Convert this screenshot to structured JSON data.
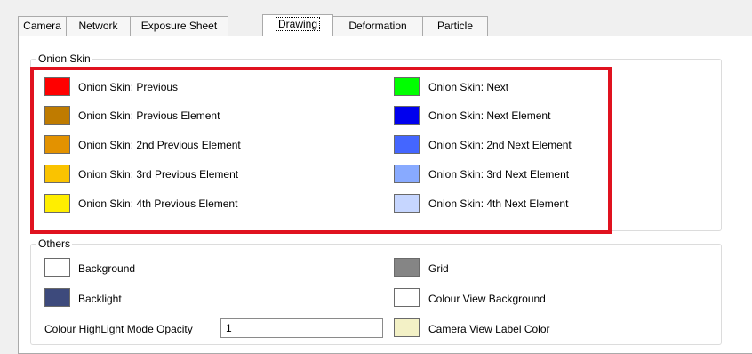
{
  "tabs": [
    {
      "label": "Camera"
    },
    {
      "label": "Network"
    },
    {
      "label": "Exposure Sheet"
    },
    {
      "label": "Drawing"
    },
    {
      "label": "Deformation"
    },
    {
      "label": "Particle"
    }
  ],
  "active_tab": "Drawing",
  "onion_skin": {
    "title": "Onion Skin",
    "left": [
      {
        "label": "Onion Skin: Previous",
        "color": "#ff0000"
      },
      {
        "label": "Onion Skin: Previous Element",
        "color": "#bf7b00"
      },
      {
        "label": "Onion Skin: 2nd Previous Element",
        "color": "#e39200"
      },
      {
        "label": "Onion Skin: 3rd Previous Element",
        "color": "#fac300"
      },
      {
        "label": "Onion Skin: 4th Previous Element",
        "color": "#ffee00"
      }
    ],
    "right": [
      {
        "label": "Onion Skin: Next",
        "color": "#00ff00"
      },
      {
        "label": "Onion Skin: Next Element",
        "color": "#0000ee"
      },
      {
        "label": "Onion Skin: 2nd Next Element",
        "color": "#4466ff"
      },
      {
        "label": "Onion Skin: 3rd Next Element",
        "color": "#88aaff"
      },
      {
        "label": "Onion Skin: 4th Next Element",
        "color": "#c6d6ff"
      }
    ]
  },
  "others": {
    "title": "Others",
    "background": {
      "label": "Background",
      "color": "#ffffff"
    },
    "backlight": {
      "label": "Backlight",
      "color": "#3d4a7c"
    },
    "opacity": {
      "label": "Colour HighLight Mode Opacity",
      "value": "1"
    },
    "grid": {
      "label": "Grid",
      "color": "#858585"
    },
    "colour_view_background": {
      "label": "Colour View Background",
      "color": "#ffffff"
    },
    "camera_view_label_color": {
      "label": "Camera View Label Color",
      "color": "#f3f1c6"
    }
  },
  "highlight_color": "#e0121f"
}
